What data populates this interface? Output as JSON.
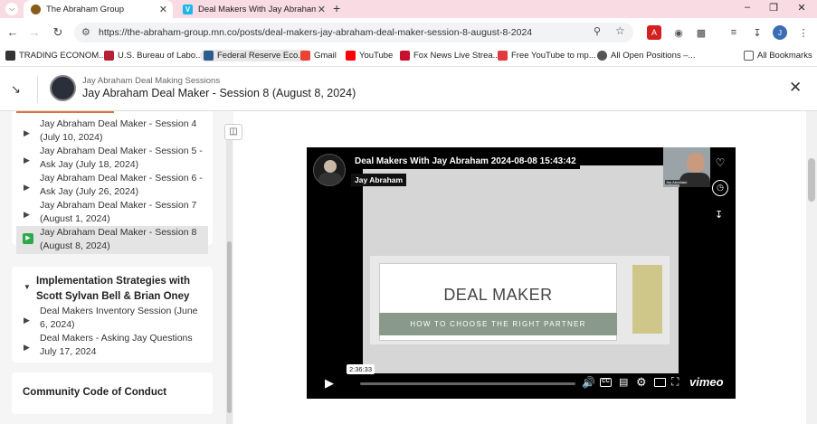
{
  "browser": {
    "tabs": [
      {
        "title": "The Abraham Group",
        "favicon_color": "#8a5a18"
      },
      {
        "title": "Deal Makers With Jay Abraham",
        "favicon_color": "#1ab7ea"
      }
    ],
    "url": "https://the-abraham-group.mn.co/posts/deal-makers-jay-abraham-deal-maker-session-8-august-8-2024",
    "bookmarks": [
      {
        "label": "TRADING ECONOM...",
        "color": "#333333"
      },
      {
        "label": "U.S. Bureau of Labo...",
        "color": "#b22234"
      },
      {
        "label": "Federal Reserve Eco...",
        "color": "#2e5c8a"
      },
      {
        "label": "Gmail",
        "color": "#ea4335"
      },
      {
        "label": "YouTube",
        "color": "#ff0000"
      },
      {
        "label": "Fox News Live Strea...",
        "color": "#c8102e"
      },
      {
        "label": "Free YouTube to mp...",
        "color": "#e03a3e"
      },
      {
        "label": "All Open Positions –...",
        "color": "#555555"
      }
    ],
    "all_bookmarks": "All Bookmarks"
  },
  "header": {
    "breadcrumb": "Jay Abraham Deal Making Sessions",
    "title": "Jay Abraham Deal Maker - Session 8 (August 8, 2024)"
  },
  "sidebar": {
    "lessons": [
      {
        "label": "Jay Abraham Deal Maker - Session 4 (July 10, 2024)"
      },
      {
        "label": "Jay Abraham Deal Maker - Session 5 - Ask Jay (July 18, 2024)"
      },
      {
        "label": "Jay Abraham Deal Maker - Session 6 - Ask Jay (July 26, 2024)"
      },
      {
        "label": "Jay Abraham Deal Maker - Session 7 (August 1, 2024)"
      },
      {
        "label": "Jay Abraham Deal Maker - Session 8 (August 8, 2024)",
        "active": true
      }
    ],
    "section2": {
      "title": "Implementation Strategies with Scott Sylvan Bell & Brian Oney",
      "lessons": [
        {
          "label": "Deal Makers Inventory Session (June 6, 2024)"
        },
        {
          "label": "Deal Makers - Asking Jay Questions July 17, 2024"
        }
      ]
    },
    "section3": {
      "title": "Community Code of Conduct"
    }
  },
  "video": {
    "title": "Deal Makers With Jay Abraham 2024-08-08 15:43:42",
    "author": "Jay Abraham",
    "slide_heading": "DEAL MAKER",
    "slide_subheading": "HOW TO CHOOSE THE RIGHT PARTNER",
    "timestamp": "2:36:33",
    "cam_label": "Jay Abraham",
    "brand": "vimeo",
    "progress": 0.0
  }
}
